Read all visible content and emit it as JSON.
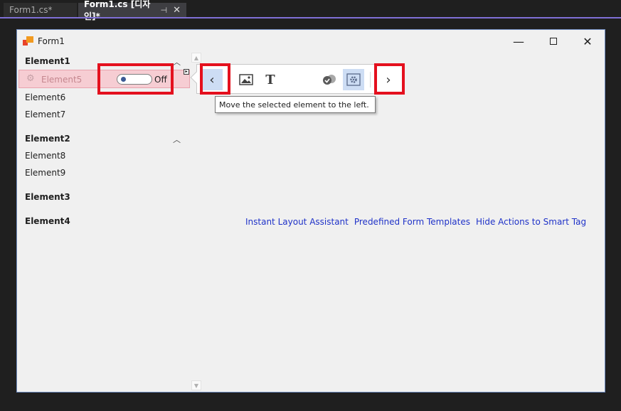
{
  "ide": {
    "tabs": [
      {
        "label": "Form1.cs*"
      },
      {
        "label": "Form1.cs [디자인]*",
        "pin": "⊣",
        "close": "✕"
      }
    ]
  },
  "form": {
    "title": "Form1",
    "window_controls": {
      "minimize": "—",
      "close": "✕"
    }
  },
  "groups": [
    {
      "header": "Element1",
      "items": [
        "Element5",
        "Element6",
        "Element7"
      ]
    },
    {
      "header": "Element2",
      "items": [
        "Element8",
        "Element9"
      ]
    },
    {
      "header": "Element3",
      "items": []
    },
    {
      "header": "Element4",
      "items": []
    }
  ],
  "selected_item": {
    "label": "Element5",
    "toggle_state": "Off"
  },
  "toolbar": {
    "buttons": [
      "chevron-left",
      "image",
      "text",
      "check-circle",
      "settings",
      "chevron-right"
    ],
    "text_glyph": "T",
    "left_glyph": "‹",
    "right_glyph": "›"
  },
  "tooltip": "Move the selected element to the left.",
  "links": [
    "Instant Layout Assistant",
    "Predefined Form Templates",
    "Hide Actions to Smart Tag"
  ],
  "colors": {
    "selection_bg": "#f6cdd3",
    "highlight_border": "#e4101e",
    "link": "#1f32c8",
    "accent": "#7f6fd6"
  }
}
